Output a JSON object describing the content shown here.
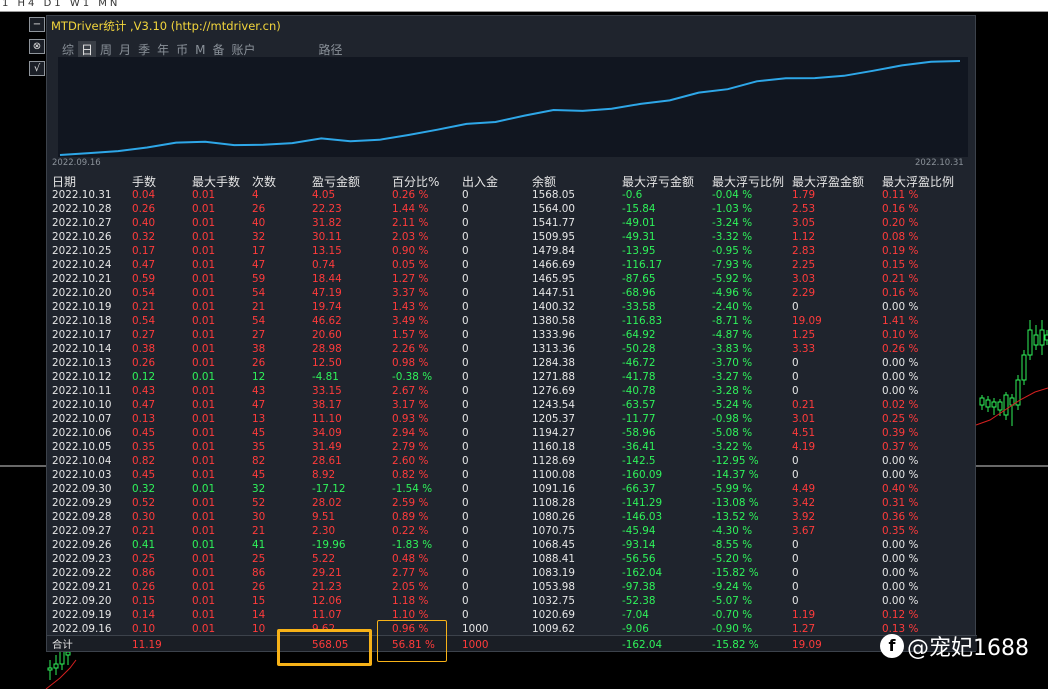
{
  "topbar": {
    "text": "1 H4 D1 W1 MN"
  },
  "controls": {
    "minus": "−",
    "target": "⊗",
    "check": "√"
  },
  "panel": {
    "title": "MTDriver统计 ,V3.10 (http://mtdriver.cn)",
    "tabs": [
      "综",
      "日",
      "周",
      "月",
      "季",
      "年",
      "币",
      "M",
      "备",
      "账户",
      "路径"
    ],
    "active_tab": "日",
    "chart_start": "2022.09.16",
    "chart_end": "2022.10.31",
    "line_color": "#2ea7e8"
  },
  "headers": [
    "日期",
    "手数",
    "最大手数",
    "次数",
    "盈亏金额",
    "百分比%",
    "出入金",
    "余额",
    "最大浮亏金额",
    "最大浮亏比例",
    "最大浮盈金额",
    "最大浮盈比例"
  ],
  "colors": {
    "profit": "#ff3b3b",
    "loss": "#2ff25a",
    "neutral": "#e6e6e6",
    "highlight": "#f7b218"
  },
  "rows": [
    [
      "2022.10.31",
      "0.04",
      "0.01",
      "4",
      "4.05",
      "0.26 %",
      "0",
      "1568.05",
      "-0.6",
      "-0.04 %",
      "1.79",
      "0.11 %"
    ],
    [
      "2022.10.28",
      "0.26",
      "0.01",
      "26",
      "22.23",
      "1.44 %",
      "0",
      "1564.00",
      "-15.84",
      "-1.03 %",
      "2.53",
      "0.16 %"
    ],
    [
      "2022.10.27",
      "0.40",
      "0.01",
      "40",
      "31.82",
      "2.11 %",
      "0",
      "1541.77",
      "-49.01",
      "-3.24 %",
      "3.05",
      "0.20 %"
    ],
    [
      "2022.10.26",
      "0.32",
      "0.01",
      "32",
      "30.11",
      "2.03 %",
      "0",
      "1509.95",
      "-49.31",
      "-3.32 %",
      "1.12",
      "0.08 %"
    ],
    [
      "2022.10.25",
      "0.17",
      "0.01",
      "17",
      "13.15",
      "0.90 %",
      "0",
      "1479.84",
      "-13.95",
      "-0.95 %",
      "2.83",
      "0.19 %"
    ],
    [
      "2022.10.24",
      "0.47",
      "0.01",
      "47",
      "0.74",
      "0.05 %",
      "0",
      "1466.69",
      "-116.17",
      "-7.93 %",
      "2.25",
      "0.15 %"
    ],
    [
      "2022.10.21",
      "0.59",
      "0.01",
      "59",
      "18.44",
      "1.27 %",
      "0",
      "1465.95",
      "-87.65",
      "-5.92 %",
      "3.03",
      "0.21 %"
    ],
    [
      "2022.10.20",
      "0.54",
      "0.01",
      "54",
      "47.19",
      "3.37 %",
      "0",
      "1447.51",
      "-68.96",
      "-4.96 %",
      "2.29",
      "0.16 %"
    ],
    [
      "2022.10.19",
      "0.21",
      "0.01",
      "21",
      "19.74",
      "1.43 %",
      "0",
      "1400.32",
      "-33.58",
      "-2.40 %",
      "0",
      "0.00 %"
    ],
    [
      "2022.10.18",
      "0.54",
      "0.01",
      "54",
      "46.62",
      "3.49 %",
      "0",
      "1380.58",
      "-116.83",
      "-8.71 %",
      "19.09",
      "1.41 %"
    ],
    [
      "2022.10.17",
      "0.27",
      "0.01",
      "27",
      "20.60",
      "1.57 %",
      "0",
      "1333.96",
      "-64.92",
      "-4.87 %",
      "1.25",
      "0.10 %"
    ],
    [
      "2022.10.14",
      "0.38",
      "0.01",
      "38",
      "28.98",
      "2.26 %",
      "0",
      "1313.36",
      "-50.28",
      "-3.83 %",
      "3.33",
      "0.26 %"
    ],
    [
      "2022.10.13",
      "0.26",
      "0.01",
      "26",
      "12.50",
      "0.98 %",
      "0",
      "1284.38",
      "-46.72",
      "-3.70 %",
      "0",
      "0.00 %"
    ],
    [
      "2022.10.12",
      "0.12",
      "0.01",
      "12",
      "-4.81",
      "-0.38 %",
      "0",
      "1271.88",
      "-41.78",
      "-3.27 %",
      "0",
      "0.00 %"
    ],
    [
      "2022.10.11",
      "0.43",
      "0.01",
      "43",
      "33.15",
      "2.67 %",
      "0",
      "1276.69",
      "-40.78",
      "-3.28 %",
      "0",
      "0.00 %"
    ],
    [
      "2022.10.10",
      "0.47",
      "0.01",
      "47",
      "38.17",
      "3.17 %",
      "0",
      "1243.54",
      "-63.57",
      "-5.24 %",
      "0.21",
      "0.02 %"
    ],
    [
      "2022.10.07",
      "0.13",
      "0.01",
      "13",
      "11.10",
      "0.93 %",
      "0",
      "1205.37",
      "-11.77",
      "-0.98 %",
      "3.01",
      "0.25 %"
    ],
    [
      "2022.10.06",
      "0.45",
      "0.01",
      "45",
      "34.09",
      "2.94 %",
      "0",
      "1194.27",
      "-58.96",
      "-5.08 %",
      "4.51",
      "0.39 %"
    ],
    [
      "2022.10.05",
      "0.35",
      "0.01",
      "35",
      "31.49",
      "2.79 %",
      "0",
      "1160.18",
      "-36.41",
      "-3.22 %",
      "4.19",
      "0.37 %"
    ],
    [
      "2022.10.04",
      "0.82",
      "0.01",
      "82",
      "28.61",
      "2.60 %",
      "0",
      "1128.69",
      "-142.5",
      "-12.95 %",
      "0",
      "0.00 %"
    ],
    [
      "2022.10.03",
      "0.45",
      "0.01",
      "45",
      "8.92",
      "0.82 %",
      "0",
      "1100.08",
      "-160.09",
      "-14.37 %",
      "0",
      "0.00 %"
    ],
    [
      "2022.09.30",
      "0.32",
      "0.01",
      "32",
      "-17.12",
      "-1.54 %",
      "0",
      "1091.16",
      "-66.37",
      "-5.99 %",
      "4.49",
      "0.40 %"
    ],
    [
      "2022.09.29",
      "0.52",
      "0.01",
      "52",
      "28.02",
      "2.59 %",
      "0",
      "1108.28",
      "-141.29",
      "-13.08 %",
      "3.42",
      "0.31 %"
    ],
    [
      "2022.09.28",
      "0.30",
      "0.01",
      "30",
      "9.51",
      "0.89 %",
      "0",
      "1080.26",
      "-146.03",
      "-13.52 %",
      "3.92",
      "0.36 %"
    ],
    [
      "2022.09.27",
      "0.21",
      "0.01",
      "21",
      "2.30",
      "0.22 %",
      "0",
      "1070.75",
      "-45.94",
      "-4.30 %",
      "3.67",
      "0.35 %"
    ],
    [
      "2022.09.26",
      "0.41",
      "0.01",
      "41",
      "-19.96",
      "-1.83 %",
      "0",
      "1068.45",
      "-93.14",
      "-8.55 %",
      "0",
      "0.00 %"
    ],
    [
      "2022.09.23",
      "0.25",
      "0.01",
      "25",
      "5.22",
      "0.48 %",
      "0",
      "1088.41",
      "-56.56",
      "-5.20 %",
      "0",
      "0.00 %"
    ],
    [
      "2022.09.22",
      "0.86",
      "0.01",
      "86",
      "29.21",
      "2.77 %",
      "0",
      "1083.19",
      "-162.04",
      "-15.82 %",
      "0",
      "0.00 %"
    ],
    [
      "2022.09.21",
      "0.26",
      "0.01",
      "26",
      "21.23",
      "2.05 %",
      "0",
      "1053.98",
      "-97.38",
      "-9.24 %",
      "0",
      "0.00 %"
    ],
    [
      "2022.09.20",
      "0.15",
      "0.01",
      "15",
      "12.06",
      "1.18 %",
      "0",
      "1032.75",
      "-52.38",
      "-5.07 %",
      "0",
      "0.00 %"
    ],
    [
      "2022.09.19",
      "0.14",
      "0.01",
      "14",
      "11.07",
      "1.10 %",
      "0",
      "1020.69",
      "-7.04",
      "-0.70 %",
      "1.19",
      "0.12 %"
    ],
    [
      "2022.09.16",
      "0.10",
      "0.01",
      "10",
      "9.62",
      "0.96 %",
      "1000",
      "1009.62",
      "-9.06",
      "-0.90 %",
      "1.27",
      "0.13 %"
    ]
  ],
  "total": {
    "label": "合计",
    "lots": "11.19",
    "profit": "568.05",
    "percent": "56.81 %",
    "deposit": "1000",
    "max_float_loss": "-162.04",
    "max_float_loss_pct": "-15.82 %",
    "max_float_profit": "19.09"
  },
  "watermark": {
    "icon": "f",
    "text": "@宠妃1688"
  }
}
